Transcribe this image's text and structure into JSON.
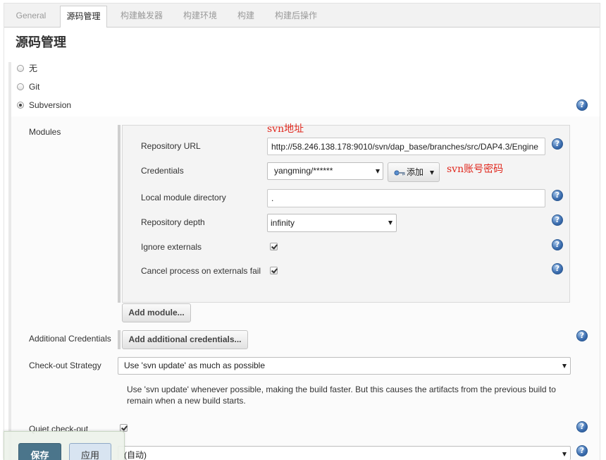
{
  "tabs": [
    {
      "label": "General",
      "active": false
    },
    {
      "label": "源码管理",
      "active": true
    },
    {
      "label": "构建触发器",
      "active": false
    },
    {
      "label": "构建环境",
      "active": false
    },
    {
      "label": "构建",
      "active": false
    },
    {
      "label": "构建后操作",
      "active": false
    }
  ],
  "section": {
    "title": "源码管理"
  },
  "scm_options": [
    {
      "label": "无",
      "selected": false
    },
    {
      "label": "Git",
      "selected": false
    },
    {
      "label": "Subversion",
      "selected": true
    }
  ],
  "subversion": {
    "modules": {
      "label": "Modules",
      "repository_url": {
        "label": "Repository URL",
        "value": "http://58.246.138.178:9010/svn/dap_base/branches/src/DAP4.3/Engine",
        "annotation": "svn地址"
      },
      "credentials": {
        "label": "Credentials",
        "value": "yangming/******",
        "add_button_label": "添加",
        "add_button_icon": "key-icon",
        "annotation": "svn账号密码"
      },
      "local_module_directory": {
        "label": "Local module directory",
        "value": "."
      },
      "repository_depth": {
        "label": "Repository depth",
        "value": "infinity"
      },
      "ignore_externals": {
        "label": "Ignore externals",
        "checked": true
      },
      "cancel_process_on_externals_fail": {
        "label": "Cancel process on externals fail",
        "checked": true
      },
      "add_module_label": "Add module..."
    },
    "additional_credentials": {
      "label": "Additional Credentials",
      "button_label": "Add additional credentials..."
    },
    "checkout_strategy": {
      "label": "Check-out Strategy",
      "value": "Use 'svn update' as much as possible",
      "description_lines": [
        "Use 'svn update' whenever possible, making the build faster. But this causes the artifacts from the previous build to",
        "remain when a new build starts."
      ]
    },
    "quiet_checkout": {
      "label": "Quiet check-out",
      "checked": true
    },
    "repository_browser": {
      "value": "(自动)"
    }
  },
  "footer": {
    "save_label": "保存",
    "apply_label": "应用"
  },
  "icons": {
    "help": "help-icon",
    "key": "key-icon",
    "dropdown": "chevron-down-icon"
  },
  "colors": {
    "save_button": "#4b758b",
    "apply_button": "#d8e4f1",
    "annotation": "#e0281e",
    "help_icon": "#3a6cae"
  }
}
